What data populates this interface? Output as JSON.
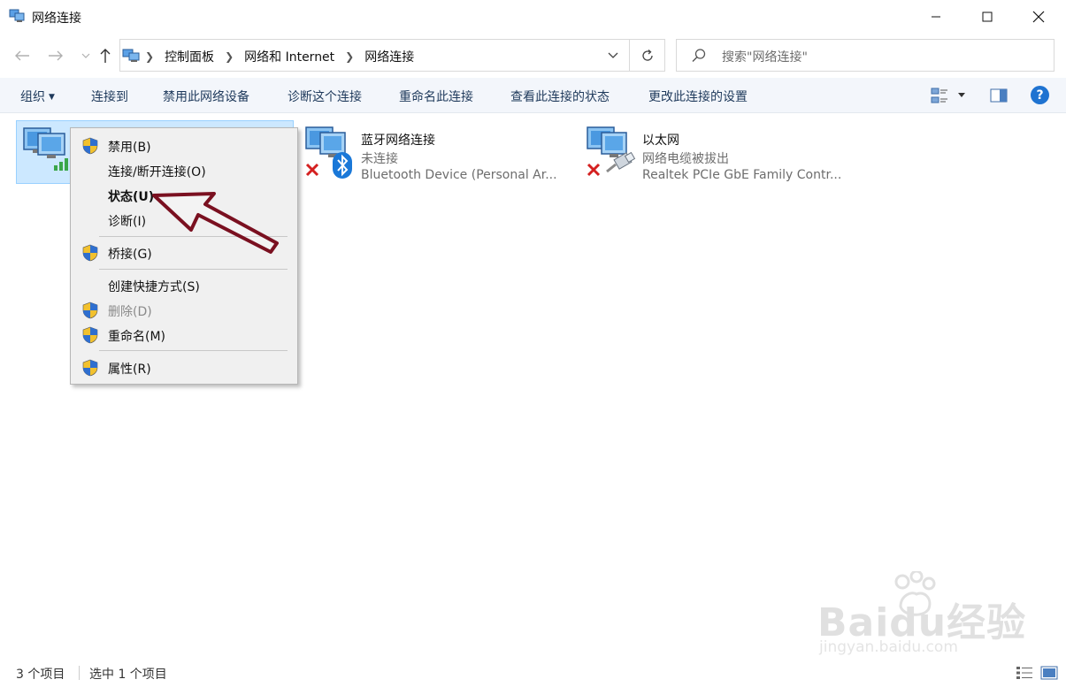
{
  "window": {
    "title": "网络连接"
  },
  "address": {
    "crumbs": [
      "控制面板",
      "网络和 Internet",
      "网络连接"
    ]
  },
  "search": {
    "placeholder": "搜索\"网络连接\""
  },
  "commands": {
    "organize": "组织",
    "connect_to": "连接到",
    "disable_device": "禁用此网络设备",
    "diagnose": "诊断这个连接",
    "rename": "重命名此连接",
    "view_status": "查看此连接的状态",
    "change_settings": "更改此连接的设置"
  },
  "connections": [
    {
      "name": "",
      "status": "",
      "device": "",
      "selected": true
    },
    {
      "name": "蓝牙网络连接",
      "status": "未连接",
      "device": "Bluetooth Device (Personal Ar..."
    },
    {
      "name": "以太网",
      "status": "网络电缆被拔出",
      "device": "Realtek PCIe GbE Family Contr..."
    }
  ],
  "context_menu": {
    "items": [
      {
        "label": "禁用(B)",
        "shield": true
      },
      {
        "label": "连接/断开连接(O)",
        "shield": false
      },
      {
        "label": "状态(U)",
        "shield": false,
        "bold": true
      },
      {
        "label": "诊断(I)",
        "shield": false
      },
      {
        "label": "桥接(G)",
        "shield": true
      },
      {
        "label": "创建快捷方式(S)",
        "shield": false
      },
      {
        "label": "删除(D)",
        "shield": true,
        "disabled": true
      },
      {
        "label": "重命名(M)",
        "shield": true
      },
      {
        "label": "属性(R)",
        "shield": true
      }
    ]
  },
  "statusbar": {
    "count": "3 个项目",
    "selected": "选中 1 个项目"
  },
  "watermark": {
    "brand": "Baidu经验",
    "url": "jingyan.baidu.com"
  },
  "colors": {
    "accent": "#1f73d1",
    "selection_bg": "#cce8ff",
    "arrow": "#7a1020",
    "command_text": "#1e395b"
  },
  "icons": [
    "network-app-icon",
    "back-arrow-icon",
    "forward-arrow-icon",
    "up-arrow-icon",
    "refresh-icon",
    "search-icon",
    "shield-icon",
    "bluetooth-icon",
    "ethernet-cable-icon",
    "red-x-icon",
    "help-icon"
  ]
}
